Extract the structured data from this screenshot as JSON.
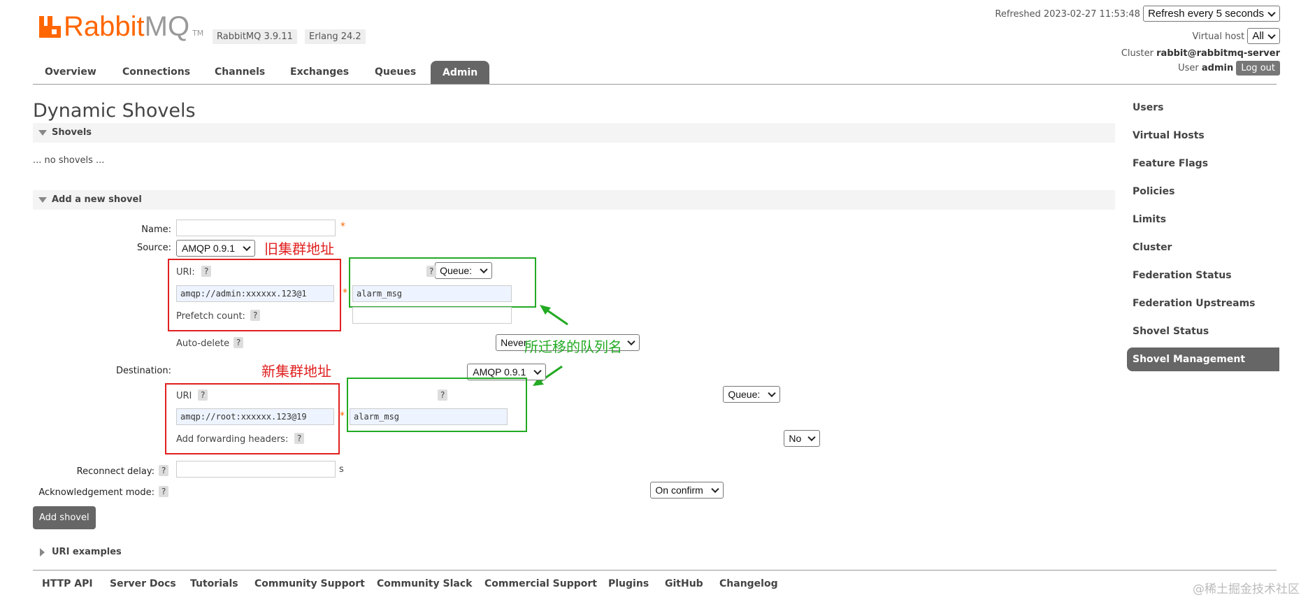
{
  "brand": {
    "name_a": "Rabbit",
    "name_b": "MQ",
    "tm": "TM",
    "version": "RabbitMQ 3.9.11",
    "erlang": "Erlang 24.2",
    "color": "#ff6600"
  },
  "header": {
    "refreshed_label": "Refreshed 2023-02-27 11:53:48",
    "refresh_select": "Refresh every 5 seconds",
    "vhost_label": "Virtual host",
    "vhost_select": "All",
    "cluster_label": "Cluster",
    "cluster_name": "rabbit@rabbitmq-server",
    "user_label": "User",
    "user_name": "admin",
    "logout": "Log out"
  },
  "tabs": [
    "Overview",
    "Connections",
    "Channels",
    "Exchanges",
    "Queues",
    "Admin"
  ],
  "page": {
    "title": "Dynamic Shovels",
    "shovels_section": "Shovels",
    "no_shovels": "... no shovels ...",
    "add_section": "Add a new shovel",
    "uri_examples": "URI examples"
  },
  "form": {
    "name_label": "Name:",
    "required": "*",
    "source_label": "Source:",
    "source_protocol": "AMQP 0.9.1",
    "src_uri_label": "URI:",
    "src_uri_value": "amqp://admin:xxxxxx.123@1",
    "src_type": "Queue:",
    "src_queue_value": "alarm_msg",
    "prefetch_label": "Prefetch count:",
    "autodelete_label": "Auto-delete",
    "autodelete_value": "Never",
    "dest_label": "Destination:",
    "dest_protocol": "AMQP 0.9.1",
    "dest_uri_label": "URI",
    "dest_uri_value": "amqp://root:xxxxxx.123@19",
    "dest_type": "Queue:",
    "dest_queue_value": "alarm_msg",
    "fwd_headers_label": "Add forwarding headers:",
    "fwd_headers_value": "No",
    "reconnect_label": "Reconnect delay:",
    "reconnect_unit": "s",
    "ack_label": "Acknowledgement mode:",
    "ack_value": "On confirm",
    "help": "?",
    "submit": "Add shovel"
  },
  "annotations": {
    "old_cluster": "旧集群地址",
    "new_cluster": "新集群地址",
    "queue_name": "所迁移的队列名",
    "red": "#e02020",
    "green": "#22aa22"
  },
  "sidebar": [
    "Users",
    "Virtual Hosts",
    "Feature Flags",
    "Policies",
    "Limits",
    "Cluster",
    "Federation Status",
    "Federation Upstreams",
    "Shovel Status",
    "Shovel Management"
  ],
  "footer": [
    "HTTP API",
    "Server Docs",
    "Tutorials",
    "Community Support",
    "Community Slack",
    "Commercial Support",
    "Plugins",
    "GitHub",
    "Changelog"
  ],
  "watermark": "@稀土掘金技术社区"
}
